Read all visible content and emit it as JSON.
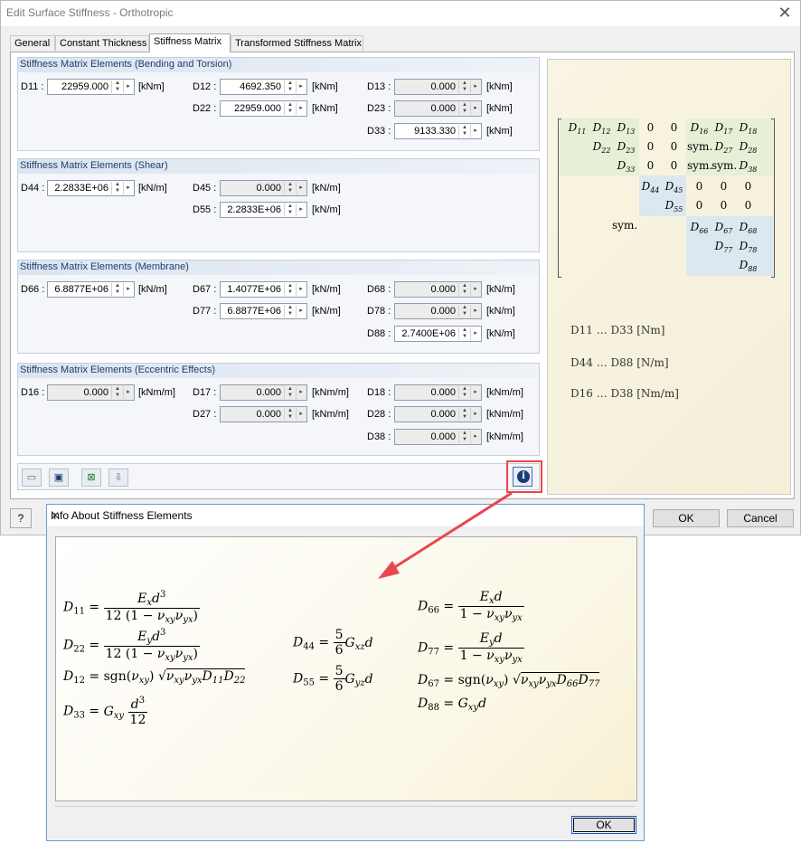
{
  "window": {
    "title": "Edit Surface Stiffness - Orthotropic"
  },
  "tabs": [
    {
      "label": "General"
    },
    {
      "label": "Constant Thickness"
    },
    {
      "label": "Stiffness Matrix"
    },
    {
      "label": "Transformed Stiffness Matrix"
    }
  ],
  "groups": {
    "bending": {
      "title": "Stiffness Matrix Elements (Bending and Torsion)",
      "D11": {
        "label": "D11 :",
        "value": "22959.000",
        "unit": "[kNm]"
      },
      "D12": {
        "label": "D12 :",
        "value": "4692.350",
        "unit": "[kNm]"
      },
      "D13": {
        "label": "D13 :",
        "value": "0.000",
        "unit": "[kNm]"
      },
      "D22": {
        "label": "D22 :",
        "value": "22959.000",
        "unit": "[kNm]"
      },
      "D23": {
        "label": "D23 :",
        "value": "0.000",
        "unit": "[kNm]"
      },
      "D33": {
        "label": "D33 :",
        "value": "9133.330",
        "unit": "[kNm]"
      }
    },
    "shear": {
      "title": "Stiffness Matrix Elements (Shear)",
      "D44": {
        "label": "D44 :",
        "value": "2.2833E+06",
        "unit": "[kN/m]"
      },
      "D45": {
        "label": "D45 :",
        "value": "0.000",
        "unit": "[kN/m]"
      },
      "D55": {
        "label": "D55 :",
        "value": "2.2833E+06",
        "unit": "[kN/m]"
      }
    },
    "membrane": {
      "title": "Stiffness Matrix Elements (Membrane)",
      "D66": {
        "label": "D66 :",
        "value": "6.8877E+06",
        "unit": "[kN/m]"
      },
      "D67": {
        "label": "D67 :",
        "value": "1.4077E+06",
        "unit": "[kN/m]"
      },
      "D68": {
        "label": "D68 :",
        "value": "0.000",
        "unit": "[kN/m]"
      },
      "D77": {
        "label": "D77 :",
        "value": "6.8877E+06",
        "unit": "[kN/m]"
      },
      "D78": {
        "label": "D78 :",
        "value": "0.000",
        "unit": "[kN/m]"
      },
      "D88": {
        "label": "D88 :",
        "value": "2.7400E+06",
        "unit": "[kN/m]"
      }
    },
    "eccentric": {
      "title": "Stiffness Matrix Elements (Eccentric Effects)",
      "D16": {
        "label": "D16 :",
        "value": "0.000",
        "unit": "[kNm/m]"
      },
      "D17": {
        "label": "D17 :",
        "value": "0.000",
        "unit": "[kNm/m]"
      },
      "D18": {
        "label": "D18 :",
        "value": "0.000",
        "unit": "[kNm/m]"
      },
      "D27": {
        "label": "D27 :",
        "value": "0.000",
        "unit": "[kNm/m]"
      },
      "D28": {
        "label": "D28 :",
        "value": "0.000",
        "unit": "[kNm/m]"
      },
      "D38": {
        "label": "D38 :",
        "value": "0.000",
        "unit": "[kNm/m]"
      }
    }
  },
  "preview": {
    "matrix_sym": "sym.",
    "legend": [
      "D11 … D33  [Nm]",
      "D44 … D88  [N/m]",
      "D16 … D38  [Nm/m]"
    ]
  },
  "buttons": {
    "ok": "OK",
    "cancel": "Cancel"
  },
  "dialog": {
    "title": "Info About Stiffness Elements",
    "ok": "OK"
  },
  "colors": {
    "highlight": "#e8474f",
    "group_title": "#1e3d6b",
    "accent": "#0a58c2"
  },
  "icons": [
    "open-icon",
    "save-icon",
    "export-excel-icon",
    "import-icon",
    "info-icon",
    "help-icon",
    "close-icon",
    "spin-up-down-icon",
    "spin-arrow-icon"
  ]
}
